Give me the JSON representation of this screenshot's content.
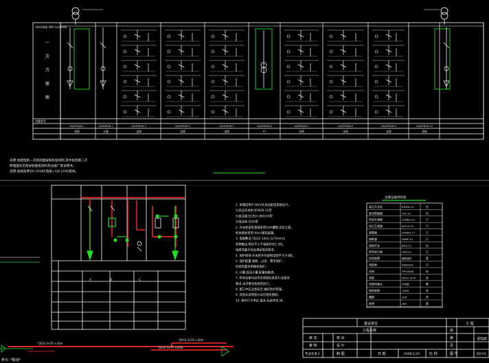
{
  "panel_top": {
    "row_label": "设备型号",
    "col_labels": [
      "一",
      "次",
      "方",
      "案",
      "图"
    ],
    "tag_row_1": [
      "AA/KYN28-1",
      "AA/KYN28-2",
      "AA/KYN28-3",
      "AA/KYN28-4",
      "AA/KYN28-5",
      "AA/KYN28-6",
      "AA/KYN28-7",
      "AA/KYN28-8",
      "AA/KYN28-9",
      "AA/KYN28-10"
    ],
    "tag_row_2": [
      "进线",
      "计量",
      "出线",
      "出线",
      "出线",
      "PT",
      "出线",
      "出线",
      "出线",
      "进线"
    ]
  },
  "notes_top": [
    "说明:本配电柜一次系统图按照标准绘制,其中各回路二次",
    "     原理图详见附录各图纸资料及设备厂家说明书。",
    "说明:进线采用YJV-3X185电缆+YJV-1X95接地。"
  ],
  "notes_right": [
    "1. 本图适用于10kV开关站配电系统设计。",
    "   1)高压开关柜:KYN28-12型",
    "   2)变压器:SCB10-800/10型",
    "   3)低压柜:GGD型",
    "2. 开关柜安装基础采用10#槽钢,详见土建。",
    "   柜体接地采用-40x4镀锌扁钢。",
    "3. 电缆敷设:YJV22-10kV,3x70mm2",
    "   穿管敷设,管径不小于电缆外径1.5倍。",
    "   电缆弯曲半径应满足规范要求。",
    "4. 保护接地:开关柜外壳接地电阻不大于4欧。",
    "5. 保护配置:速断、过流、零序保护。",
    "   综保装置采用微机保护。",
    "6. 计量:高压计量,配置电能表。",
    "7. 所有设备均应符合国家标准及行业规范",
    "   要求,未尽事宜按规范执行。",
    "8. 施工中应注意安全,做好防护措施。",
    "9. 其他未说明部分详见相关图纸。",
    "10. 图中尺寸单位:毫米,标高单位:米。"
  ],
  "table_right": {
    "header": "主要设备材料表",
    "rows": [
      [
        "高压开关柜",
        "KYN28-12",
        "台"
      ],
      [
        "真空断路器",
        "VS1-12",
        "台"
      ],
      [
        "电流互感器",
        "LZZBJ9-10",
        "只"
      ],
      [
        "电压互感器",
        "JDZ10-10",
        "只"
      ],
      [
        "避雷器",
        "HY5WZ-17",
        "只"
      ],
      [
        "熔断器",
        "XRNP-10",
        "只"
      ],
      [
        "接地开关",
        "JN15-12",
        "台"
      ],
      [
        "带电显示器",
        "GSN-10",
        "只"
      ],
      [
        "综保装置",
        "微机保护",
        "套"
      ],
      [
        "电能表",
        "DSSD331",
        "只"
      ],
      [
        "母线",
        "TMY-80x8",
        "米"
      ],
      [
        "电缆",
        "YJV22-3x70",
        "米"
      ],
      [
        "电缆终端头",
        "户内型",
        "套"
      ],
      [
        "接地扁钢",
        "-40x4",
        "米"
      ],
      [
        "槽钢",
        "10#",
        "米"
      ],
      [
        "照明",
        "LED",
        "套"
      ]
    ]
  },
  "title_block": {
    "project_label": "建设单位",
    "project_name_label": "工程名称",
    "design_label": "工  程",
    "drawing_label": "配电图",
    "row_labels": [
      "审  定",
      "审  核",
      "专业负责人"
    ],
    "col_labels": [
      "校  对",
      "设  计",
      "制  图"
    ],
    "date_label": "日  期",
    "date_value": "2008.5.20",
    "scale_label": "比  例",
    "no_label": "图  号",
    "no_value": "RD-01",
    "sheet_label": "张",
    "extra": "第",
    "page_label": "页"
  },
  "bottom_cable_labels": [
    "YJV22-3x70  ×20m",
    "YJV22-3x70  ×20m",
    "YJV22-3x70  ×20m"
  ],
  "corner_text": "命令: *取消*"
}
